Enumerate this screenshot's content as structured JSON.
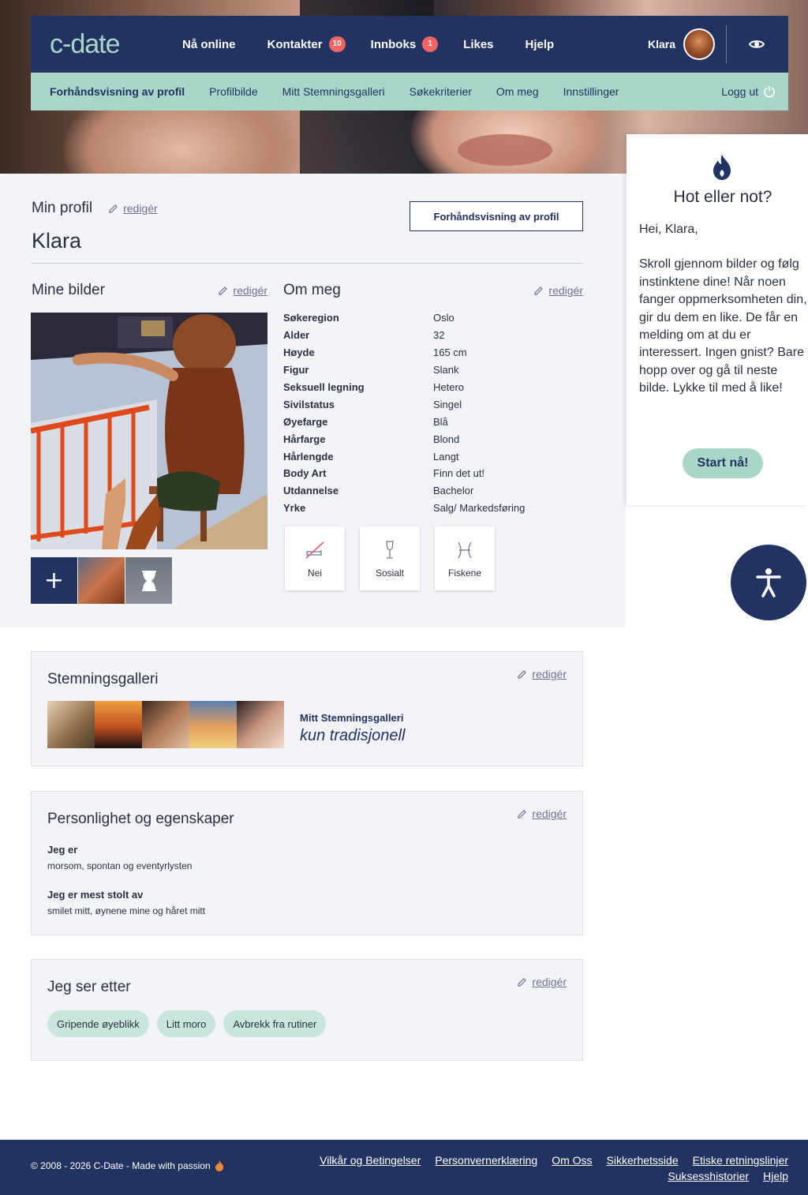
{
  "brand": {
    "logo_text": "c-date"
  },
  "topnav": {
    "items": [
      {
        "label": "Nå online"
      },
      {
        "label": "Kontakter",
        "badge": "10"
      },
      {
        "label": "Innboks",
        "badge": "1"
      },
      {
        "label": "Likes"
      },
      {
        "label": "Hjelp"
      }
    ],
    "user_name": "Klara"
  },
  "subnav": {
    "items": [
      {
        "label": "Forhåndsvisning av profil",
        "active": true
      },
      {
        "label": "Profilbilde"
      },
      {
        "label": "Mitt Stemningsgalleri"
      },
      {
        "label": "Søkekriterier"
      },
      {
        "label": "Om meg"
      },
      {
        "label": "Innstillinger"
      }
    ],
    "logout_label": "Logg ut"
  },
  "profile": {
    "section_title": "Min profil",
    "edit_label": "redigér",
    "name": "Klara",
    "preview_button": "Forhåndsvisning av profil",
    "photos_title": "Mine bilder",
    "add_photo_symbol": "+",
    "about_title": "Om meg",
    "about": [
      {
        "key": "Søkeregion",
        "value": "Oslo"
      },
      {
        "key": "Alder",
        "value": "32"
      },
      {
        "key": "Høyde",
        "value": "165 cm"
      },
      {
        "key": "Figur",
        "value": "Slank"
      },
      {
        "key": "Seksuell legning",
        "value": "Hetero"
      },
      {
        "key": "Sivilstatus",
        "value": "Singel"
      },
      {
        "key": "Øyefarge",
        "value": "Blå"
      },
      {
        "key": "Hårfarge",
        "value": "Blond"
      },
      {
        "key": "Hårlengde",
        "value": "Langt"
      },
      {
        "key": "Body Art",
        "value": "Finn det ut!"
      },
      {
        "key": "Utdannelse",
        "value": "Bachelor"
      },
      {
        "key": "Yrke",
        "value": "Salg/ Markedsføring"
      }
    ],
    "attributes": [
      {
        "label": "Nei",
        "icon": "no-smoking-icon"
      },
      {
        "label": "Sosialt",
        "icon": "champagne-glass-icon"
      },
      {
        "label": "Fiskene",
        "icon": "pisces-icon"
      }
    ]
  },
  "hot_or_not": {
    "title": "Hot eller not?",
    "greeting": "Hei, Klara,",
    "body": "Skroll gjennom bilder og følg instinktene dine! Når noen fanger oppmerksomheten din, gir du dem en like. De får en melding om at du er interessert. Ingen gnist? Bare hopp over og gå til neste bilde. Lykke til med å like!",
    "button": "Start nå!"
  },
  "gallery_card": {
    "title": "Stemningsgalleri",
    "edit_label": "redigér",
    "meta_title": "Mitt Stemningsgalleri",
    "meta_sub": "kun tradisjonell"
  },
  "personality_card": {
    "title": "Personlighet og egenskaper",
    "edit_label": "redigér",
    "items": [
      {
        "key": "Jeg er",
        "value": "morsom, spontan og eventyrlysten"
      },
      {
        "key": "Jeg er mest stolt av",
        "value": "smilet mitt, øynene mine og håret mitt"
      }
    ]
  },
  "looking_card": {
    "title": "Jeg ser etter",
    "edit_label": "redigér",
    "chips": [
      "Gripende øyeblikk",
      "Litt moro",
      "Avbrekk fra rutiner"
    ]
  },
  "footer": {
    "copyright": "© 2008 - 2026 C-Date - Made with passion",
    "links": [
      "Vilkår og Betingelser",
      "Personvernerklæring",
      "Om Oss",
      "Sikkerhetsside",
      "Etiske retningslinjer",
      "Suksesshistorier",
      "Hjelp"
    ]
  },
  "colors": {
    "navy": "#223361",
    "mint": "#a9d6c9",
    "badge": "#f06464",
    "panel": "#f3f4f8"
  }
}
